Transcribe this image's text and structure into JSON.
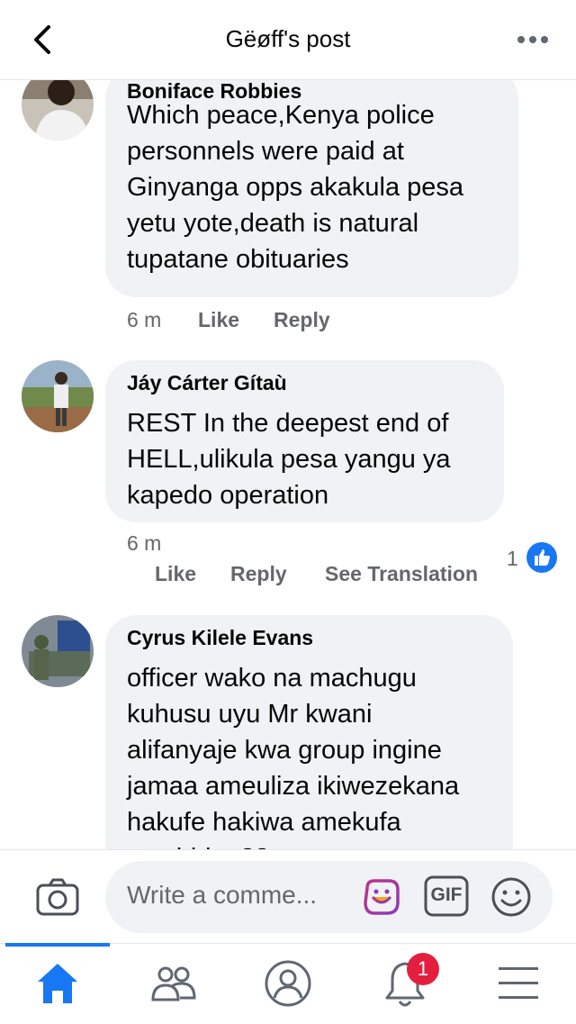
{
  "header": {
    "title": "Gëøff's post",
    "back_icon": "chevron-left-icon",
    "more_icon": "more-horizontal-icon"
  },
  "comments": [
    {
      "author": "Boniface Robbies",
      "text": "Which peace,Kenya police\npersonnels were paid at\nGinyanga opps akakula pesa\nyetu yote,death is natural\ntupatane obituaries",
      "time": "6 m",
      "like": "Like",
      "reply": "Reply"
    },
    {
      "author": "Jáy Cárter Gítaù",
      "text": "REST In the deepest end of\nHELL,ulikula pesa yangu ya\nkapedo operation",
      "time": "6 m",
      "like": "Like",
      "reply": "Reply",
      "translate": "See Translation",
      "reactions": "1"
    },
    {
      "author": "Cyrus Kilele Evans",
      "text": "officer wako na machugu\nkuhusu uyu  Mr kwani\nalifanyaje kwa group ingine\njamaa ameuliza ikiwezekana\nhakufe hakiwa amekufa\nmachid... ??"
    }
  ],
  "composer": {
    "placeholder": "Write a comme...",
    "gif_label": "GIF"
  },
  "tabbar": {
    "items": [
      "home-icon",
      "friends-icon",
      "profile-icon",
      "notifications-icon",
      "menu-icon"
    ],
    "notification_count": "1",
    "active": "home"
  },
  "colors": {
    "accent": "#1877f2",
    "bubble": "#f0f2f5",
    "badge": "#e41e3f",
    "muted": "#65676b"
  }
}
